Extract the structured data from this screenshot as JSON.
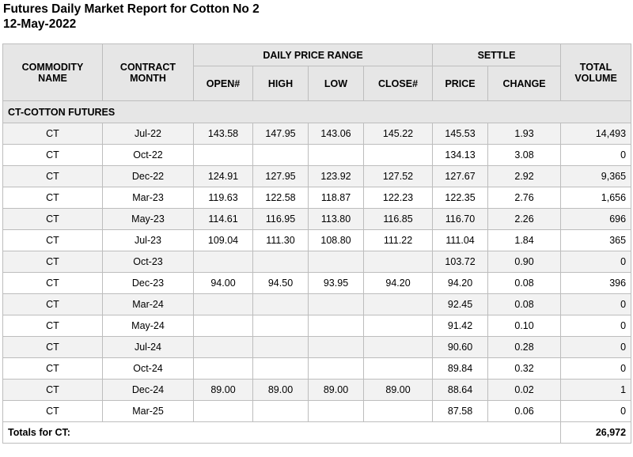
{
  "report": {
    "title": "Futures Daily Market Report for Cotton No 2",
    "date": "12-May-2022"
  },
  "headers": {
    "commodity_name": "COMMODITY NAME",
    "contract_month": "CONTRACT MONTH",
    "daily_price_range": "DAILY PRICE RANGE",
    "settle": "SETTLE",
    "open": "OPEN#",
    "high": "HIGH",
    "low": "LOW",
    "close": "CLOSE#",
    "price": "PRICE",
    "change": "CHANGE",
    "total_volume": "TOTAL VOLUME"
  },
  "group_label": "CT-COTTON FUTURES",
  "rows": [
    {
      "commodity": "CT",
      "month": "Jul-22",
      "open": "143.58",
      "high": "147.95",
      "low": "143.06",
      "close": "145.22",
      "price": "145.53",
      "change": "1.93",
      "volume": "14,493"
    },
    {
      "commodity": "CT",
      "month": "Oct-22",
      "open": "",
      "high": "",
      "low": "",
      "close": "",
      "price": "134.13",
      "change": "3.08",
      "volume": "0"
    },
    {
      "commodity": "CT",
      "month": "Dec-22",
      "open": "124.91",
      "high": "127.95",
      "low": "123.92",
      "close": "127.52",
      "price": "127.67",
      "change": "2.92",
      "volume": "9,365"
    },
    {
      "commodity": "CT",
      "month": "Mar-23",
      "open": "119.63",
      "high": "122.58",
      "low": "118.87",
      "close": "122.23",
      "price": "122.35",
      "change": "2.76",
      "volume": "1,656"
    },
    {
      "commodity": "CT",
      "month": "May-23",
      "open": "114.61",
      "high": "116.95",
      "low": "113.80",
      "close": "116.85",
      "price": "116.70",
      "change": "2.26",
      "volume": "696"
    },
    {
      "commodity": "CT",
      "month": "Jul-23",
      "open": "109.04",
      "high": "111.30",
      "low": "108.80",
      "close": "111.22",
      "price": "111.04",
      "change": "1.84",
      "volume": "365"
    },
    {
      "commodity": "CT",
      "month": "Oct-23",
      "open": "",
      "high": "",
      "low": "",
      "close": "",
      "price": "103.72",
      "change": "0.90",
      "volume": "0"
    },
    {
      "commodity": "CT",
      "month": "Dec-23",
      "open": "94.00",
      "high": "94.50",
      "low": "93.95",
      "close": "94.20",
      "price": "94.20",
      "change": "0.08",
      "volume": "396"
    },
    {
      "commodity": "CT",
      "month": "Mar-24",
      "open": "",
      "high": "",
      "low": "",
      "close": "",
      "price": "92.45",
      "change": "0.08",
      "volume": "0"
    },
    {
      "commodity": "CT",
      "month": "May-24",
      "open": "",
      "high": "",
      "low": "",
      "close": "",
      "price": "91.42",
      "change": "0.10",
      "volume": "0"
    },
    {
      "commodity": "CT",
      "month": "Jul-24",
      "open": "",
      "high": "",
      "low": "",
      "close": "",
      "price": "90.60",
      "change": "0.28",
      "volume": "0"
    },
    {
      "commodity": "CT",
      "month": "Oct-24",
      "open": "",
      "high": "",
      "low": "",
      "close": "",
      "price": "89.84",
      "change": "0.32",
      "volume": "0"
    },
    {
      "commodity": "CT",
      "month": "Dec-24",
      "open": "89.00",
      "high": "89.00",
      "low": "89.00",
      "close": "89.00",
      "price": "88.64",
      "change": "0.02",
      "volume": "1"
    },
    {
      "commodity": "CT",
      "month": "Mar-25",
      "open": "",
      "high": "",
      "low": "",
      "close": "",
      "price": "87.58",
      "change": "0.06",
      "volume": "0"
    }
  ],
  "totals": {
    "label": "Totals for CT:",
    "volume": "26,972"
  }
}
